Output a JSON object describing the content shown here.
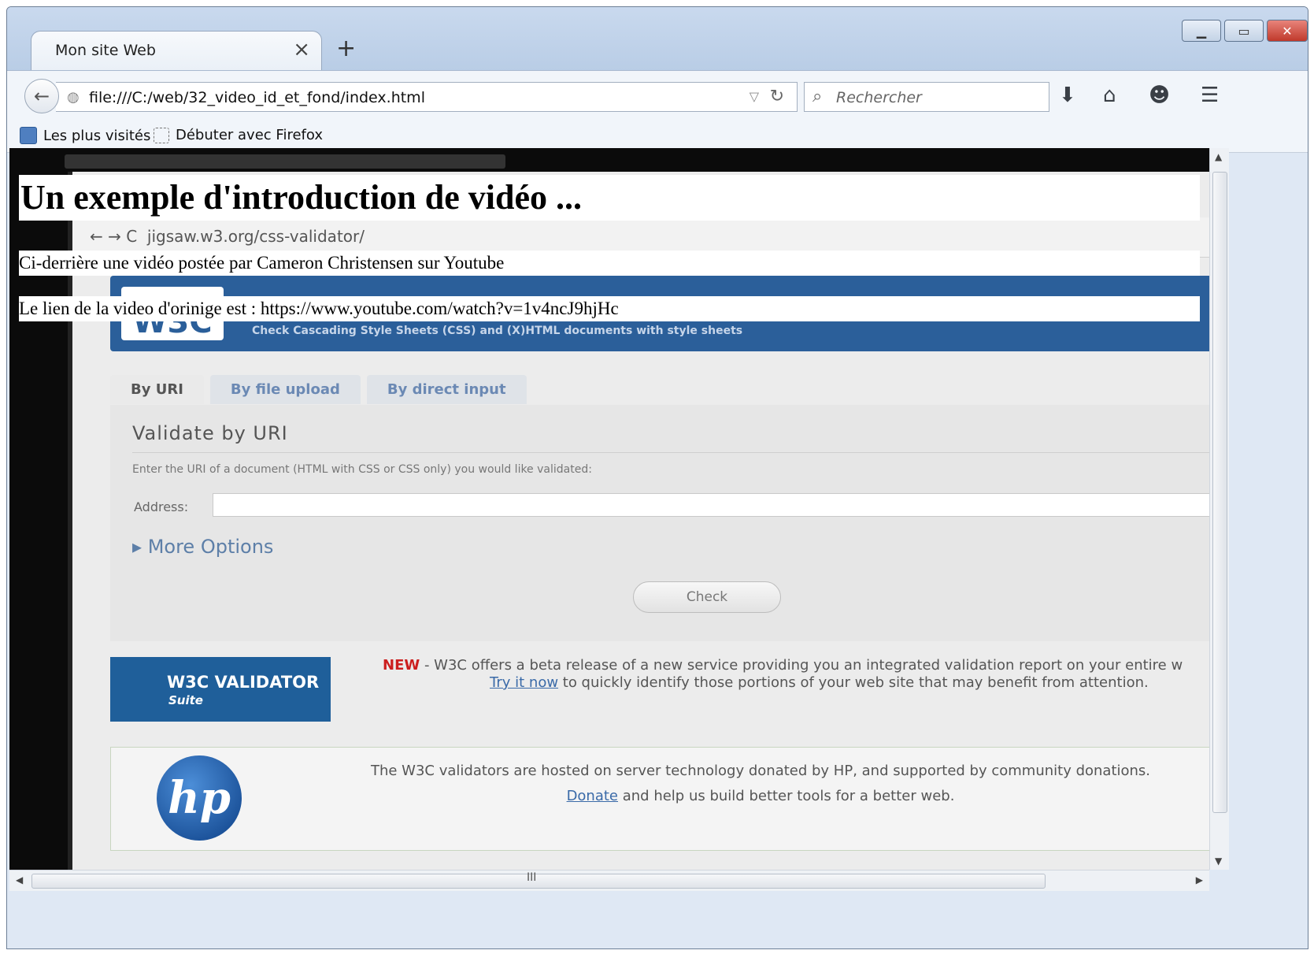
{
  "browser": {
    "tab_title": "Mon site Web",
    "tab_close": "×",
    "new_tab": "+",
    "url": "file:///C:/web/32_video_id_et_fond/index.html",
    "search_placeholder": "Rechercher",
    "bookmarks": [
      {
        "label": "Les plus visités"
      },
      {
        "label": "Débuter avec Firefox"
      }
    ],
    "icons": {
      "back": "back-arrow-icon",
      "site": "globe-icon",
      "dropdown": "url-dropdown-icon",
      "reload": "reload-icon",
      "search": "search-icon",
      "download": "download-icon",
      "home": "home-icon",
      "chat": "chat-icon",
      "menu": "hamburger-menu-icon"
    }
  },
  "page": {
    "heading": "Un exemple d'introduction de vidéo ...",
    "paragraph1": "Ci-derrière une vidéo postée par Cameron Christensen sur Youtube",
    "paragraph2": "Le lien de la video d'orinige est : https://www.youtube.com/watch?v=1v4ncJ9hjHc"
  },
  "video_frame": {
    "address": "jigsaw.w3.org/css-validator/",
    "banner_subtitle": "Check Cascading Style Sheets (CSS) and (X)HTML documents with style sheets",
    "tabs": [
      "By URI",
      "By file upload",
      "By direct input"
    ],
    "panel_title": "Validate by URI",
    "panel_hint": "Enter the URI of a document (HTML with CSS or CSS only) you would like validated:",
    "address_label": "Address:",
    "more_options": "More Options",
    "check_button": "Check",
    "suite_title": "W3C VALIDATOR",
    "suite_sub": "Suite",
    "new_label": "NEW",
    "new_text": " - W3C offers a beta release of a new service providing you an integrated validation report on your entire w",
    "try_link": "Try it now",
    "try_text": " to quickly identify those portions of your web site that may benefit from attention.",
    "hp_text": "The W3C validators are hosted on server technology donated by HP, and supported by community donations.",
    "donate_link": "Donate",
    "donate_text": " and help us build better tools for a better web."
  }
}
